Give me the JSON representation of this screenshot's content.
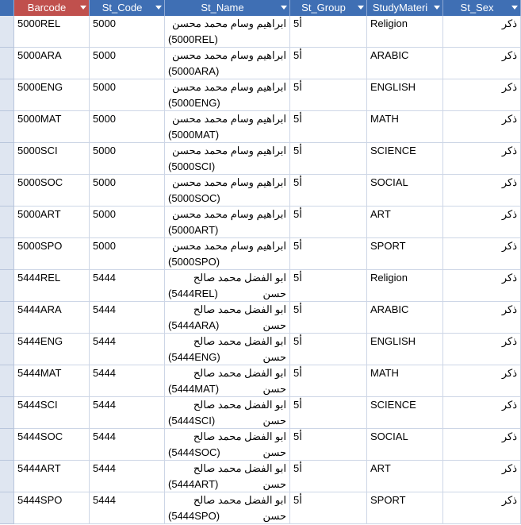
{
  "columns": [
    "Barcode",
    "St_Code",
    "St_Name",
    "St_Group",
    "StudyMateri",
    "St_Sex"
  ],
  "rows": [
    {
      "barcode": "5000REL",
      "code": "5000",
      "name_ar": "ابراهيم وسام محمد محسن",
      "name_code": "(5000REL)",
      "group": "5أ",
      "material": "Religion",
      "sex": "ذكر"
    },
    {
      "barcode": "5000ARA",
      "code": "5000",
      "name_ar": "ابراهيم وسام محمد محسن",
      "name_code": "(5000ARA)",
      "group": "5أ",
      "material": "ARABIC",
      "sex": "ذكر"
    },
    {
      "barcode": "5000ENG",
      "code": "5000",
      "name_ar": "ابراهيم وسام محمد محسن",
      "name_code": "(5000ENG)",
      "group": "5أ",
      "material": "ENGLISH",
      "sex": "ذكر"
    },
    {
      "barcode": "5000MAT",
      "code": "5000",
      "name_ar": "ابراهيم وسام محمد محسن",
      "name_code": "(5000MAT)",
      "group": "5أ",
      "material": "MATH",
      "sex": "ذكر"
    },
    {
      "barcode": "5000SCI",
      "code": "5000",
      "name_ar": "ابراهيم وسام محمد محسن",
      "name_code": "(5000SCI)",
      "group": "5أ",
      "material": "SCIENCE",
      "sex": "ذكر"
    },
    {
      "barcode": "5000SOC",
      "code": "5000",
      "name_ar": "ابراهيم وسام محمد محسن",
      "name_code": "(5000SOC)",
      "group": "5أ",
      "material": "SOCIAL",
      "sex": "ذكر"
    },
    {
      "barcode": "5000ART",
      "code": "5000",
      "name_ar": "ابراهيم وسام محمد محسن",
      "name_code": "(5000ART)",
      "group": "5أ",
      "material": "ART",
      "sex": "ذكر"
    },
    {
      "barcode": "5000SPO",
      "code": "5000",
      "name_ar": "ابراهيم وسام محمد محسن",
      "name_code": "(5000SPO)",
      "group": "5أ",
      "material": "SPORT",
      "sex": "ذكر"
    },
    {
      "barcode": "5444REL",
      "code": "5444",
      "name_ar": "ابو الفضل محمد صالح حسن",
      "name_code": "(5444REL)",
      "group": "5أ",
      "material": "Religion",
      "sex": "ذكر"
    },
    {
      "barcode": "5444ARA",
      "code": "5444",
      "name_ar": "ابو الفضل محمد صالح حسن",
      "name_code": "(5444ARA)",
      "group": "5أ",
      "material": "ARABIC",
      "sex": "ذكر"
    },
    {
      "barcode": "5444ENG",
      "code": "5444",
      "name_ar": "ابو الفضل محمد صالح حسن",
      "name_code": "(5444ENG)",
      "group": "5أ",
      "material": "ENGLISH",
      "sex": "ذكر"
    },
    {
      "barcode": "5444MAT",
      "code": "5444",
      "name_ar": "ابو الفضل محمد صالح حسن",
      "name_code": "(5444MAT)",
      "group": "5أ",
      "material": "MATH",
      "sex": "ذكر"
    },
    {
      "barcode": "5444SCI",
      "code": "5444",
      "name_ar": "ابو الفضل محمد صالح حسن",
      "name_code": "(5444SCI)",
      "group": "5أ",
      "material": "SCIENCE",
      "sex": "ذكر"
    },
    {
      "barcode": "5444SOC",
      "code": "5444",
      "name_ar": "ابو الفضل محمد صالح حسن",
      "name_code": "(5444SOC)",
      "group": "5أ",
      "material": "SOCIAL",
      "sex": "ذكر"
    },
    {
      "barcode": "5444ART",
      "code": "5444",
      "name_ar": "ابو الفضل محمد صالح حسن",
      "name_code": "(5444ART)",
      "group": "5أ",
      "material": "ART",
      "sex": "ذكر"
    },
    {
      "barcode": "5444SPO",
      "code": "5444",
      "name_ar": "ابو الفضل محمد صالح حسن",
      "name_code": "(5444SPO)",
      "group": "5أ",
      "material": "SPORT",
      "sex": "ذكر"
    }
  ],
  "colors": {
    "header_bg": "#3f6fb4",
    "active_header_bg": "#c0504d",
    "grid_line": "#cdd6e6"
  }
}
